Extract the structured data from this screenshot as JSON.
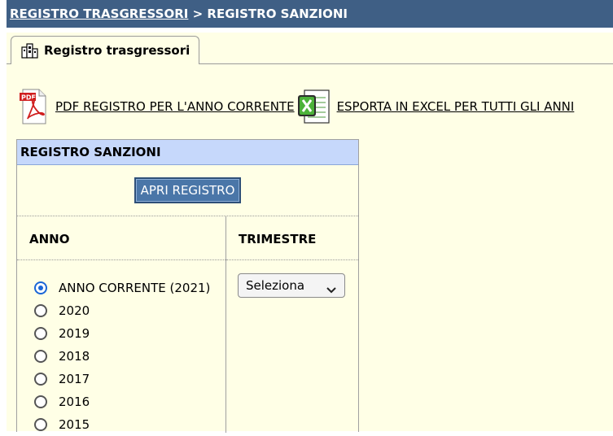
{
  "breadcrumb": {
    "link": "REGISTRO TRASGRESSORI",
    "separator": ">",
    "current": "REGISTRO SANZIONI"
  },
  "tab": {
    "label": "Registro trasgressori",
    "icon": "building-icon"
  },
  "actions": {
    "pdf_icon_text": "PDF",
    "pdf_label": "PDF REGISTRO PER L'ANNO CORRENTE",
    "excel_label": "ESPORTA IN EXCEL PER TUTTI GLI ANNI"
  },
  "panel": {
    "title": "REGISTRO SANZIONI",
    "open_button": "APRI REGISTRO",
    "anno_header": "ANNO",
    "trimestre_header": "TRIMESTRE",
    "years": [
      {
        "label": "ANNO CORRENTE (2021)",
        "checked": true
      },
      {
        "label": "2020",
        "checked": false
      },
      {
        "label": "2019",
        "checked": false
      },
      {
        "label": "2018",
        "checked": false
      },
      {
        "label": "2017",
        "checked": false
      },
      {
        "label": "2016",
        "checked": false
      },
      {
        "label": "2015",
        "checked": false
      }
    ],
    "trimestre_select": "Seleziona"
  },
  "colors": {
    "topbar": "#3f5f85",
    "content_bg": "#ffffe6",
    "panel_header": "#c6d8fb",
    "button": "#4a76a8",
    "radio_accent": "#1a66d6"
  }
}
